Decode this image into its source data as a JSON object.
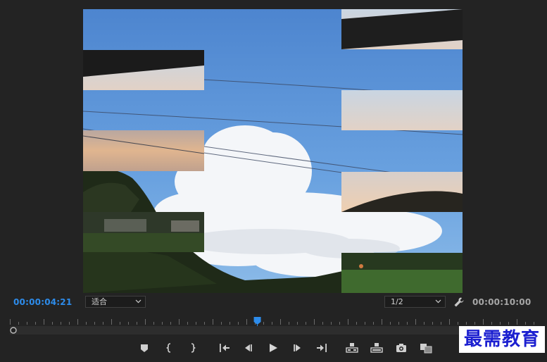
{
  "timecode": {
    "current": "00:00:04:21",
    "duration": "00:00:10:00"
  },
  "view": {
    "fit_value": "适合",
    "resolution_value": "1/2"
  },
  "playhead": {
    "position_fraction": 0.47
  },
  "transport": {
    "buttons": [
      "add-marker",
      "mark-in",
      "mark-out",
      "go-to-in",
      "step-back",
      "play",
      "step-forward",
      "go-to-out",
      "lift",
      "extract",
      "export-frame",
      "comparison-view"
    ]
  },
  "icons": {
    "fit_chevron": "chevron-down-icon",
    "resolution_chevron": "chevron-down-icon",
    "settings": "wrench-icon",
    "playhead": "playhead-icon"
  },
  "colors": {
    "panel_background": "#232323",
    "timecode_current": "#2d8ceb",
    "timecode_duration": "#a6a6a6",
    "playhead": "#2d8ceb",
    "watermark_text": "#1b1fd0"
  },
  "watermark": {
    "text": "最需教育"
  }
}
